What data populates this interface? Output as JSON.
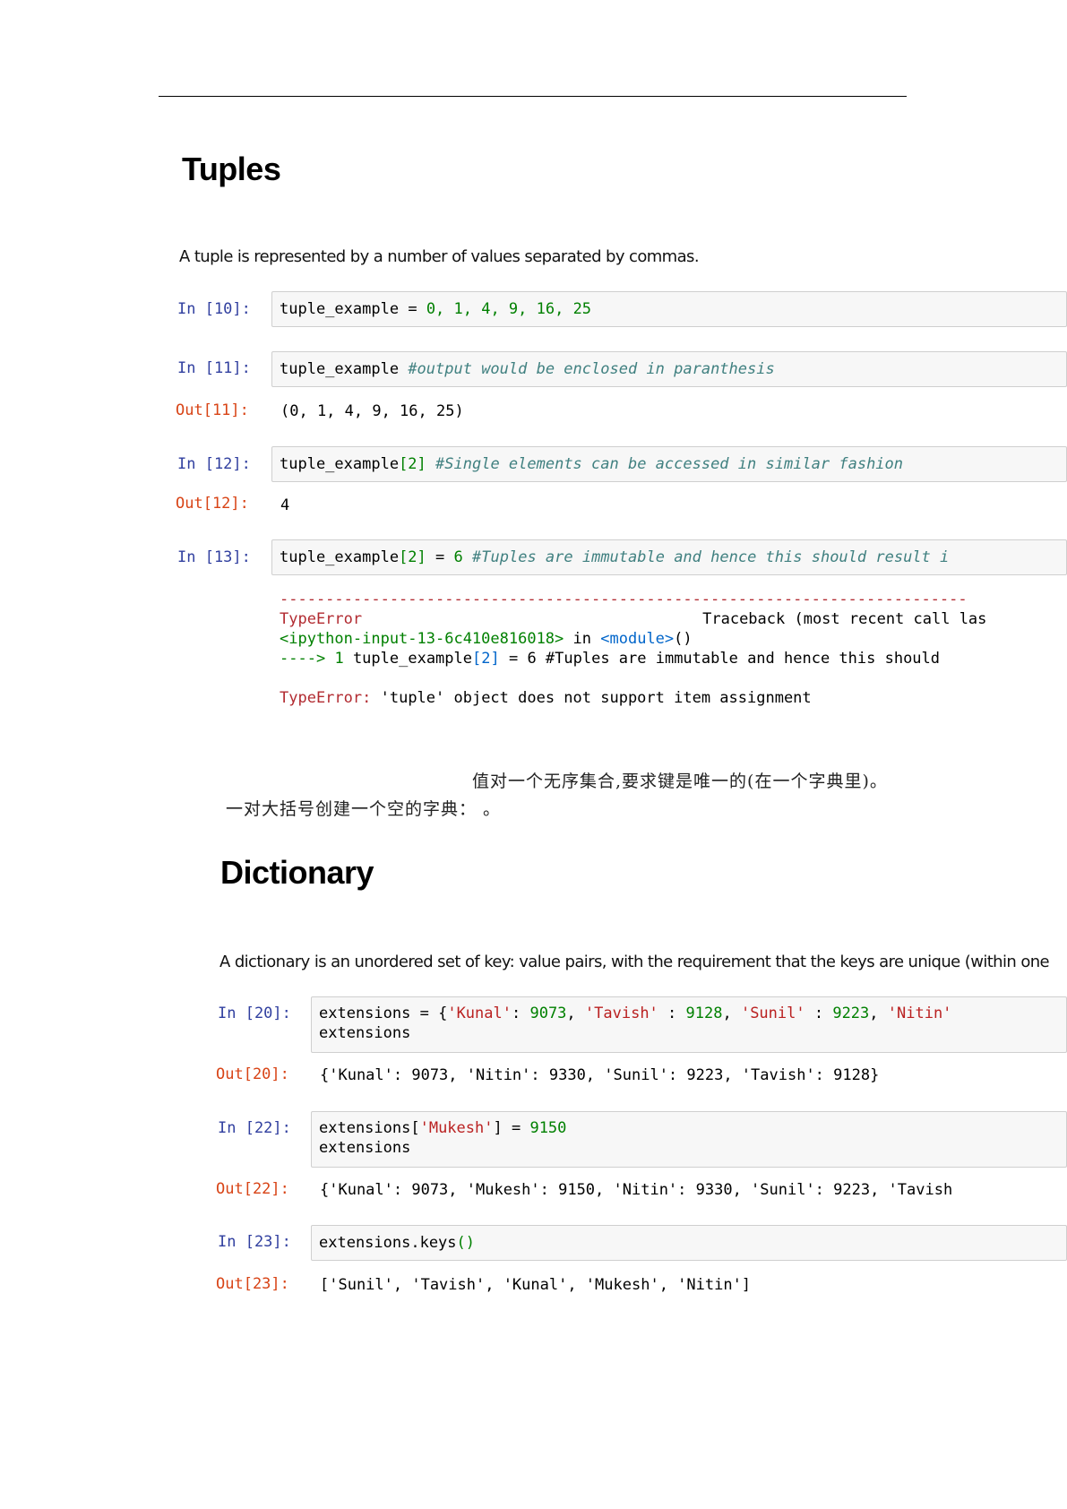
{
  "tuples": {
    "heading": "Tuples",
    "intro": "A tuple is represented by a number of values separated by commas.",
    "cell10": {
      "prompt": "In [10]:",
      "code_var": "tuple_example",
      "code_op": "=",
      "code_values": "0, 1, 4, 9, 16, 25"
    },
    "cell11": {
      "prompt": "In [11]:",
      "code_var": "tuple_example",
      "comment": "#output would be enclosed in paranthesis",
      "out_prompt": "Out[11]:",
      "output": "(0, 1, 4, 9, 16, 25)"
    },
    "cell12": {
      "prompt": "In [12]:",
      "code_var": "tuple_example",
      "code_index": "[2]",
      "comment": "#Single elements can be accessed in similar fashion",
      "out_prompt": "Out[12]:",
      "output": "4"
    },
    "cell13": {
      "prompt": "In [13]:",
      "code_var": "tuple_example",
      "code_index": "[2]",
      "code_op": "=",
      "code_value": "6",
      "comment": "#Tuples are immutable and hence this should result i"
    },
    "traceback": {
      "dashes": "---------------------------------------------------------------------------",
      "error_type": "TypeError",
      "trace_header": "Traceback (most recent call las",
      "input_ref": "<ipython-input-13-6c410e816018>",
      "in_word": "in",
      "module": "<module>",
      "parens": "()",
      "arrow": "---->",
      "line_no": "1",
      "line_code_a": "tuple_example",
      "line_code_b": "[2]",
      "line_code_c": "= 6 #Tuples are immutable and hence this should",
      "final_type": "TypeError:",
      "final_msg": "'tuple' object does not support item assignment"
    }
  },
  "chinese": {
    "line1": "值对一个无序集合,要求键是唯一的(在一个字典里)。",
    "line2": "一对大括号创建一个空的字典：   。"
  },
  "dictionary": {
    "heading": "Dictionary",
    "intro": "A dictionary is an unordered set of key: value pairs, with the requirement that the keys are unique (within one",
    "cell20": {
      "prompt": "In [20]:",
      "var": "extensions",
      "op": "= {",
      "k1": "'Kunal'",
      "v1": "9073",
      "k2": "'Tavish'",
      "v2": "9128",
      "k3": "'Sunil'",
      "v3": "9223",
      "k4": "'Nitin'",
      "line2": "extensions",
      "out_prompt": "Out[20]:",
      "output": "{'Kunal': 9073, 'Nitin': 9330, 'Sunil': 9223, 'Tavish': 9128}"
    },
    "cell22": {
      "prompt": "In [22]:",
      "var": "extensions[",
      "key": "'Mukesh'",
      "op": "] =",
      "value": "9150",
      "line2": "extensions",
      "out_prompt": "Out[22]:",
      "output": "{'Kunal': 9073, 'Mukesh': 9150, 'Nitin': 9330, 'Sunil': 9223, 'Tavish"
    },
    "cell23": {
      "prompt": "In [23]:",
      "code": "extensions.keys",
      "parens": "()",
      "out_prompt": "Out[23]:",
      "output": "['Sunil', 'Tavish', 'Kunal', 'Mukesh', 'Nitin']"
    }
  },
  "colors": {
    "in_prompt": "#303f9f",
    "out_prompt": "#d84315",
    "number": "#008000",
    "string": "#ba2121",
    "comment": "#408080",
    "error": "#b22b31"
  }
}
